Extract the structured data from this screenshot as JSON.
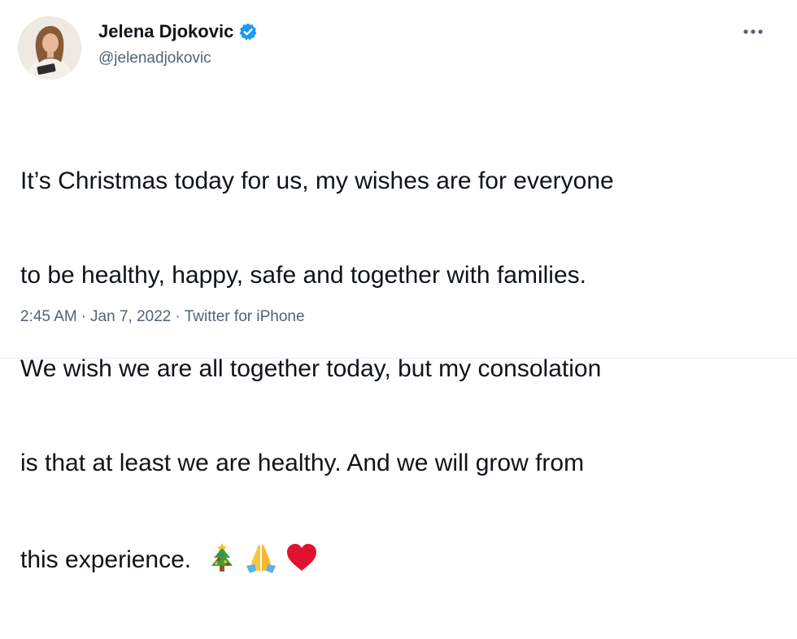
{
  "author": {
    "display_name": "Jelena Djokovic",
    "handle": "@jelenadjokovic",
    "verified": true,
    "verified_icon": "verified-badge-icon",
    "avatar": "profile-photo"
  },
  "menu": {
    "icon": "more-horizontal-icon"
  },
  "tweet": {
    "lines": [
      "It’s Christmas today for us, my wishes are for everyone",
      "to be healthy, happy, safe and together with families.",
      "We wish we are all together today, but my consolation",
      "is that at least we are healthy. And we will grow from",
      "this experience."
    ],
    "emojis": [
      "christmas-tree-icon",
      "folded-hands-icon",
      "red-heart-icon"
    ]
  },
  "meta": {
    "time": "2:45 AM",
    "separator": "·",
    "date": "Jan 7, 2022",
    "source": "Twitter for iPhone"
  },
  "colors": {
    "text": "#0f1419",
    "secondary": "#536471",
    "verified": "#1d9bf0",
    "heart": "#e0132f",
    "tree": "#3e9b30"
  }
}
